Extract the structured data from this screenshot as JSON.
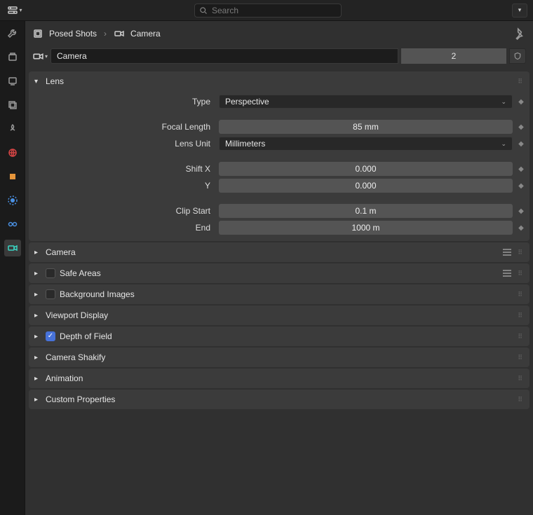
{
  "topbar": {
    "search_placeholder": "Search"
  },
  "breadcrumb": {
    "item1": "Posed Shots",
    "item2": "Camera"
  },
  "datablock": {
    "name": "Camera",
    "users": "2"
  },
  "panels": {
    "lens": {
      "title": "Lens",
      "type_label": "Type",
      "type_value": "Perspective",
      "focal_length_label": "Focal Length",
      "focal_length_value": "85 mm",
      "lens_unit_label": "Lens Unit",
      "lens_unit_value": "Millimeters",
      "shift_x_label": "Shift X",
      "shift_x_value": "0.000",
      "shift_y_label": "Y",
      "shift_y_value": "0.000",
      "clip_start_label": "Clip Start",
      "clip_start_value": "0.1 m",
      "clip_end_label": "End",
      "clip_end_value": "1000 m"
    },
    "camera": {
      "title": "Camera"
    },
    "safe_areas": {
      "title": "Safe Areas"
    },
    "bg_images": {
      "title": "Background Images"
    },
    "viewport": {
      "title": "Viewport Display"
    },
    "dof": {
      "title": "Depth of Field"
    },
    "shakify": {
      "title": "Camera Shakify"
    },
    "animation": {
      "title": "Animation"
    },
    "custom": {
      "title": "Custom Properties"
    }
  }
}
